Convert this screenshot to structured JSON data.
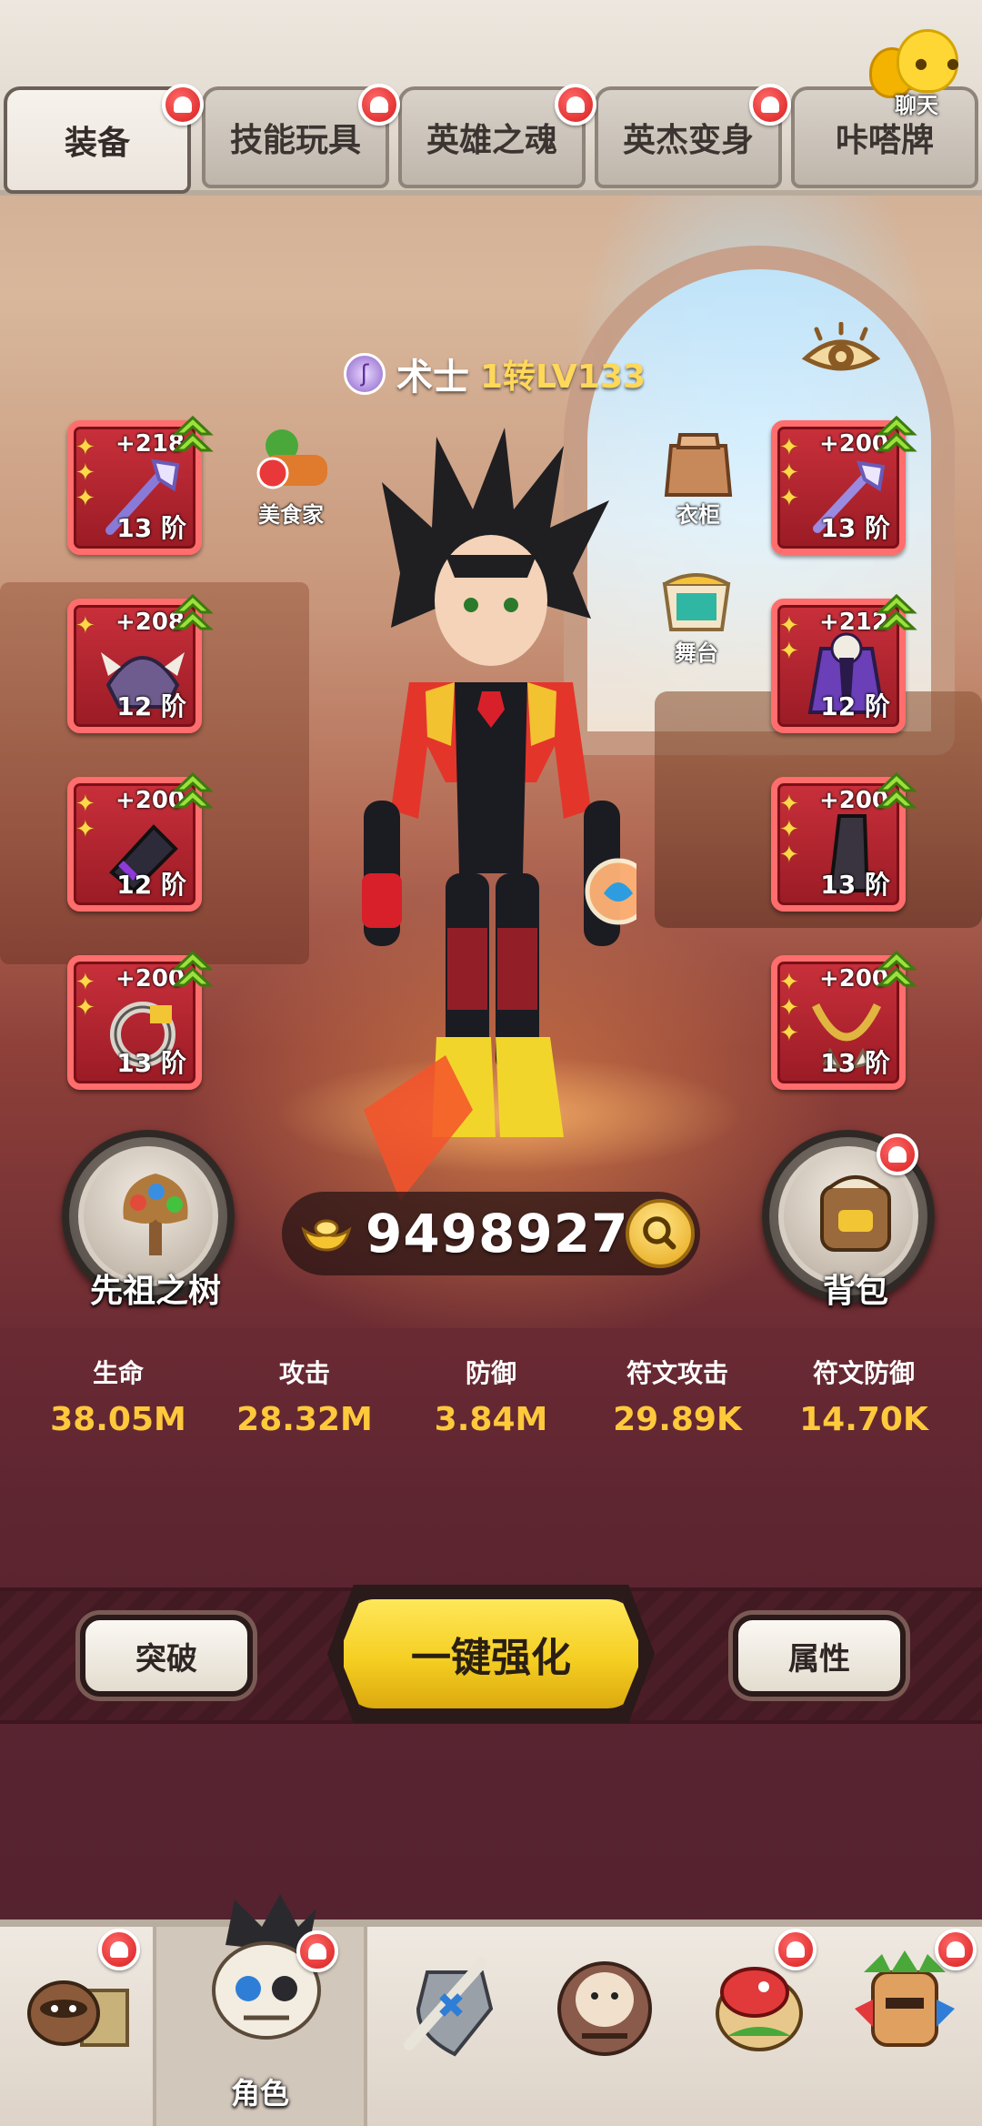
{
  "tabs": [
    {
      "label": "装备",
      "active": true,
      "badge": true
    },
    {
      "label": "技能玩具",
      "active": false,
      "badge": true
    },
    {
      "label": "英雄之魂",
      "active": false,
      "badge": true
    },
    {
      "label": "英杰变身",
      "active": false,
      "badge": true
    },
    {
      "label": "咔嗒牌",
      "active": false,
      "badge": false
    }
  ],
  "chat": {
    "label": "聊天"
  },
  "character": {
    "class_name": "术士",
    "level": "1转LV133"
  },
  "side_props": {
    "gourmet": "美食家",
    "wardrobe": "衣柜",
    "stage": "舞台"
  },
  "left_slots": [
    {
      "plus": "+218",
      "tier": "13 阶",
      "stars": 3,
      "item_icon": "staff-icon"
    },
    {
      "plus": "+208",
      "tier": "12 阶",
      "stars": 1,
      "item_icon": "beast-helmet-icon"
    },
    {
      "plus": "+200",
      "tier": "12 阶",
      "stars": 2,
      "item_icon": "bracer-icon"
    },
    {
      "plus": "+200",
      "tier": "13 阶",
      "stars": 2,
      "item_icon": "ring-icon"
    }
  ],
  "right_slots": [
    {
      "plus": "+200",
      "tier": "13 阶",
      "stars": 3,
      "item_icon": "wand-icon"
    },
    {
      "plus": "+212",
      "tier": "12 阶",
      "stars": 2,
      "item_icon": "robe-icon"
    },
    {
      "plus": "+200",
      "tier": "13 阶",
      "stars": 3,
      "item_icon": "boots-icon"
    },
    {
      "plus": "+200",
      "tier": "13 阶",
      "stars": 3,
      "item_icon": "necklace-icon"
    }
  ],
  "ancestor_tree": {
    "label": "先祖之树"
  },
  "backpack": {
    "label": "背包"
  },
  "gold": {
    "amount": "94989278"
  },
  "stats": [
    {
      "key": "生命",
      "value": "38.05M"
    },
    {
      "key": "攻击",
      "value": "28.32M"
    },
    {
      "key": "防御",
      "value": "3.84M"
    },
    {
      "key": "符文攻击",
      "value": "29.89K"
    },
    {
      "key": "符文防御",
      "value": "14.70K"
    }
  ],
  "actions": {
    "breakthrough": "突破",
    "one_click_enhance": "一键强化",
    "attributes": "属性"
  },
  "bottom_nav": [
    {
      "label": "",
      "icon": "raccoon-home-icon",
      "badge": true,
      "active": false
    },
    {
      "label": "角色",
      "icon": "character-skull-icon",
      "badge": true,
      "active": true
    },
    {
      "label": "",
      "icon": "sword-shield-icon",
      "badge": false,
      "active": false
    },
    {
      "label": "",
      "icon": "gorilla-icon",
      "badge": false,
      "active": false
    },
    {
      "label": "",
      "icon": "dragon-pet-icon",
      "badge": true,
      "active": false
    },
    {
      "label": "",
      "icon": "tribal-mask-icon",
      "badge": true,
      "active": false
    }
  ]
}
